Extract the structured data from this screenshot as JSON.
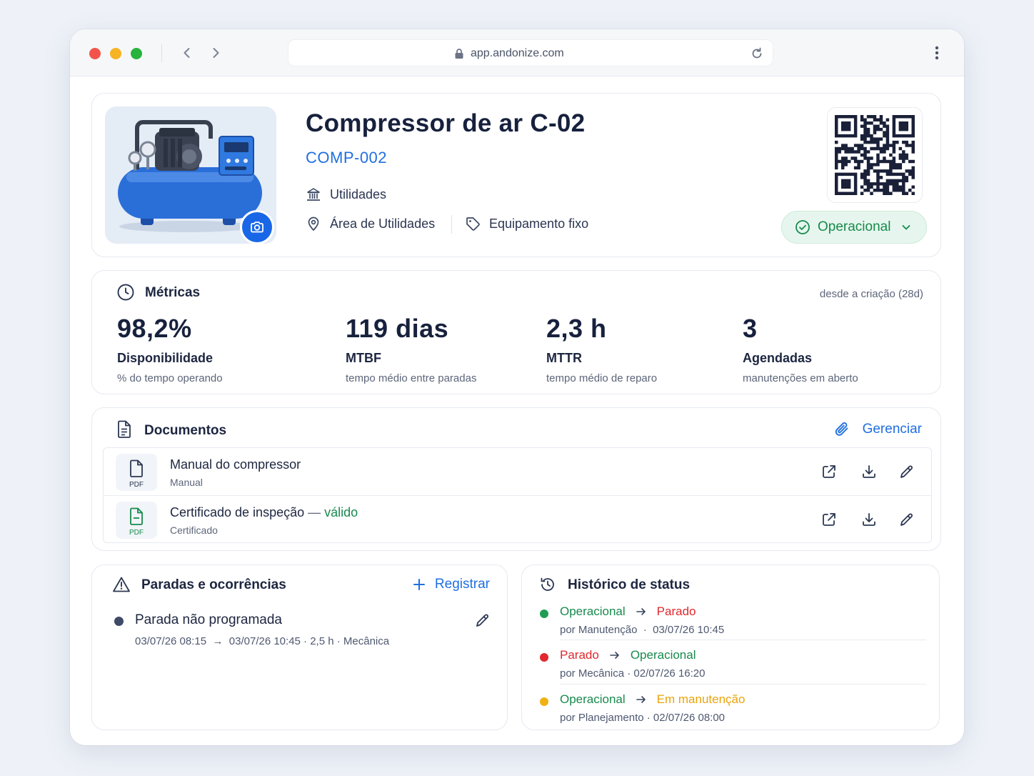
{
  "browser": {
    "url": "app.andonize.com",
    "icons": [
      "chevron-left-icon",
      "chevron-right-icon",
      "lock-icon",
      "reload-icon",
      "kebab-menu-icon"
    ]
  },
  "asset": {
    "title": "Compressor de ar C-02",
    "code": "COMP-002",
    "department": "Utilidades",
    "location": "Área de Utilidades",
    "category": "Equipamento fixo",
    "status": "Operacional",
    "status_color": "#178a4c"
  },
  "metrics": {
    "title": "Métricas",
    "since": "desde a criação (28d)",
    "items": [
      {
        "value": "98,2%",
        "label": "Disponibilidade",
        "sub": "% do tempo operando"
      },
      {
        "value": "119 dias",
        "label": "MTBF",
        "sub": "tempo médio entre paradas"
      },
      {
        "value": "2,3 h",
        "label": "MTTR",
        "sub": "tempo médio de reparo"
      },
      {
        "value": "3",
        "label": "Agendadas",
        "sub": "manutenções em aberto"
      }
    ]
  },
  "documents": {
    "title": "Documentos",
    "manage_label": "Gerenciar",
    "items": [
      {
        "name": "Manual do compressor",
        "type": "Manual",
        "badge": "PDF",
        "validity": ""
      },
      {
        "name": "Certificado de inspeção",
        "type": "Certificado",
        "badge": "PDF",
        "separator": "—",
        "validity": "válido"
      }
    ]
  },
  "stops": {
    "title": "Paradas e ocorrências",
    "register_label": "Registrar",
    "items": [
      {
        "title": "Parada não programada",
        "start": "03/07/26 08:15",
        "arrow": "→",
        "end": "03/07/26 10:45",
        "duration": "· 2,5 h ·",
        "area": "Mecânica"
      }
    ]
  },
  "history": {
    "title": "Histórico de status",
    "items": [
      {
        "from": "Operacional",
        "to": "Parado",
        "by": "por Manutenção",
        "when": "03/07/26 10:45",
        "dot_color": "#1f9d55"
      },
      {
        "from": "Parado",
        "to": "Operacional",
        "by": "por Mecânica",
        "when": "02/07/26 16:20",
        "dot_color": "#e0282e"
      },
      {
        "from": "Operacional",
        "to": "Em manutenção",
        "by": "por Planejamento",
        "when": "02/07/26 08:00",
        "dot_color": "#f0b114"
      }
    ]
  },
  "colors": {
    "accent": "#1f6fe0",
    "ok": "#178a4c",
    "stopped": "#e0282e",
    "maintenance": "#e9a40a"
  }
}
